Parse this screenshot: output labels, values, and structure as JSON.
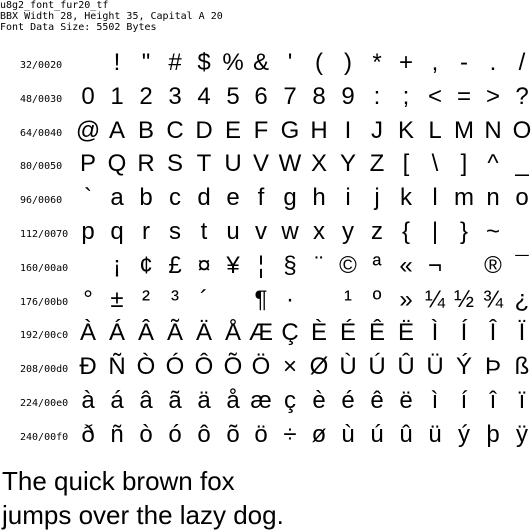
{
  "header": {
    "font_name": "u8g2_font_fur20_tf",
    "bbx_line": "BBX Width 28, Height 35, Capital A 20",
    "data_size_line": "Font Data Size: 5502 Bytes"
  },
  "rows": [
    {
      "label": "32/0020",
      "glyphs": [
        " ",
        "!",
        "\"",
        "#",
        "$",
        "%",
        "&",
        "'",
        "(",
        ")",
        "*",
        "+",
        ",",
        "-",
        ".",
        "/"
      ]
    },
    {
      "label": "48/0030",
      "glyphs": [
        "0",
        "1",
        "2",
        "3",
        "4",
        "5",
        "6",
        "7",
        "8",
        "9",
        ":",
        ";",
        "<",
        "=",
        ">",
        "?"
      ]
    },
    {
      "label": "64/0040",
      "glyphs": [
        "@",
        "A",
        "B",
        "C",
        "D",
        "E",
        "F",
        "G",
        "H",
        "I",
        "J",
        "K",
        "L",
        "M",
        "N",
        "O"
      ]
    },
    {
      "label": "80/0050",
      "glyphs": [
        "P",
        "Q",
        "R",
        "S",
        "T",
        "U",
        "V",
        "W",
        "X",
        "Y",
        "Z",
        "[",
        "\\",
        "]",
        "^",
        "_"
      ]
    },
    {
      "label": "96/0060",
      "glyphs": [
        "`",
        "a",
        "b",
        "c",
        "d",
        "e",
        "f",
        "g",
        "h",
        "i",
        "j",
        "k",
        "l",
        "m",
        "n",
        "o"
      ]
    },
    {
      "label": "112/0070",
      "glyphs": [
        "p",
        "q",
        "r",
        "s",
        "t",
        "u",
        "v",
        "w",
        "x",
        "y",
        "z",
        "{",
        "|",
        "}",
        "~",
        ""
      ]
    },
    {
      "label": "160/00a0",
      "glyphs": [
        " ",
        "¡",
        "¢",
        "£",
        "¤",
        "¥",
        "¦",
        "§",
        "¨",
        "©",
        "ª",
        "«",
        "¬",
        "",
        "®",
        "¯"
      ]
    },
    {
      "label": "176/00b0",
      "glyphs": [
        "°",
        "±",
        "²",
        "³",
        "´",
        "",
        "¶",
        "·",
        "",
        "¹",
        "º",
        "»",
        "¼",
        "½",
        "¾",
        "¿"
      ]
    },
    {
      "label": "192/00c0",
      "glyphs": [
        "À",
        "Á",
        "Â",
        "Ã",
        "Ä",
        "Å",
        "Æ",
        "Ç",
        "È",
        "É",
        "Ê",
        "Ë",
        "Ì",
        "Í",
        "Î",
        "Ï"
      ]
    },
    {
      "label": "208/00d0",
      "glyphs": [
        "Ð",
        "Ñ",
        "Ò",
        "Ó",
        "Ô",
        "Õ",
        "Ö",
        "×",
        "Ø",
        "Ù",
        "Ú",
        "Û",
        "Ü",
        "Ý",
        "Þ",
        "ß"
      ]
    },
    {
      "label": "224/00e0",
      "glyphs": [
        "à",
        "á",
        "â",
        "ã",
        "ä",
        "å",
        "æ",
        "ç",
        "è",
        "é",
        "ê",
        "ë",
        "ì",
        "í",
        "î",
        "ï"
      ]
    },
    {
      "label": "240/00f0",
      "glyphs": [
        "ð",
        "ñ",
        "ò",
        "ó",
        "ô",
        "õ",
        "ö",
        "÷",
        "ø",
        "ù",
        "ú",
        "û",
        "ü",
        "ý",
        "þ",
        "ÿ"
      ]
    }
  ],
  "sample": {
    "line1": "The quick brown fox",
    "line2": "jumps over the lazy dog."
  }
}
